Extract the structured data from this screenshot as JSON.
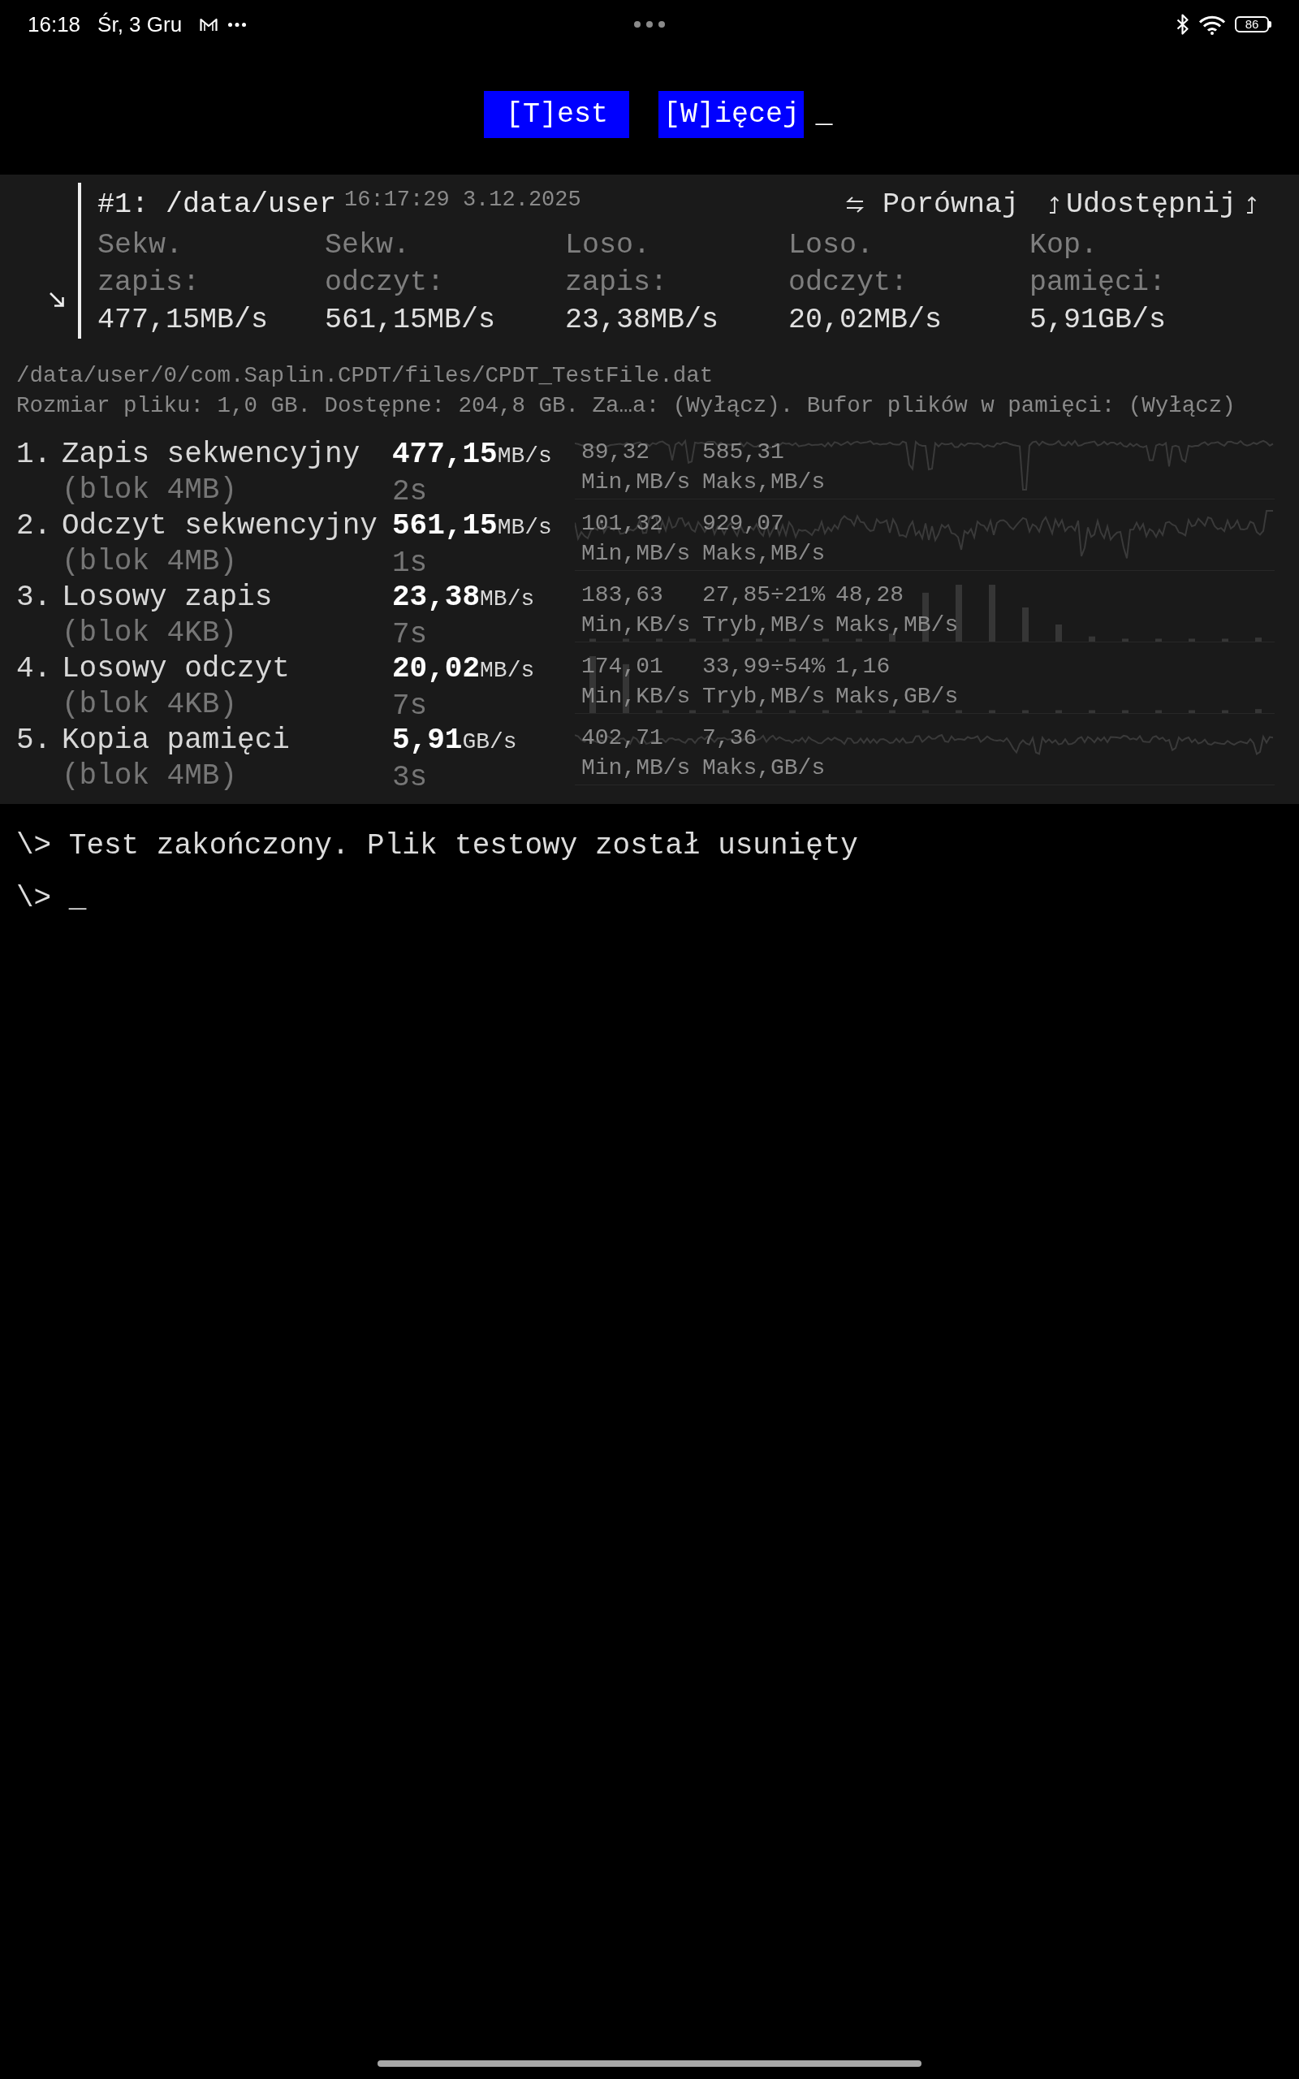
{
  "status_bar": {
    "time": "16:18",
    "date": "Śr, 3 Gru",
    "battery": "86"
  },
  "menu": {
    "buttons": [
      "[T]est",
      "[W]ięcej"
    ],
    "cursor": "_"
  },
  "result": {
    "title": "#1: /data/user",
    "timestamp": "16:17:29 3.12.2025",
    "actions": [
      {
        "kind": "compare",
        "label": "Porównaj"
      },
      {
        "kind": "share",
        "label": "Udostępnij"
      }
    ],
    "summary": [
      {
        "label": "Sekw. zapis:",
        "value": "477,15MB/s"
      },
      {
        "label": "Sekw. odczyt:",
        "value": "561,15MB/s"
      },
      {
        "label": "Loso. zapis:",
        "value": "23,38MB/s"
      },
      {
        "label": "Loso. odczyt:",
        "value": "20,02MB/s"
      },
      {
        "label": "Kop. pamięci:",
        "value": "5,91GB/s"
      }
    ]
  },
  "file": {
    "path": "/data/user/0/com.Saplin.CPDT/files/CPDT_TestFile.dat",
    "info": "Rozmiar pliku: 1,0 GB. Dostępne: 204,8 GB. Za…a: (Wyłącz). Bufor plików w pamięci: (Wyłącz)"
  },
  "tests": [
    {
      "number": "1.",
      "name": "Zapis sekwencyjny",
      "block": "(blok 4MB)",
      "speed": "477,15",
      "unit": "MB/s",
      "time": "2s",
      "kind": "sparkline",
      "stats": [
        {
          "value": "89,32",
          "label": "Min,MB/s"
        },
        {
          "value": "585,31",
          "label": "Maks,MB/s"
        }
      ]
    },
    {
      "number": "2.",
      "name": "Odczyt sekwencyjny",
      "block": "(blok 4MB)",
      "speed": "561,15",
      "unit": "MB/s",
      "time": "1s",
      "kind": "sparkline",
      "stats": [
        {
          "value": "101,32",
          "label": "Min,MB/s"
        },
        {
          "value": "929,07",
          "label": "Maks,MB/s"
        }
      ]
    },
    {
      "number": "3.",
      "name": "Losowy zapis",
      "block": "(blok 4KB)",
      "speed": "23,38",
      "unit": "MB/s",
      "time": "7s",
      "kind": "histogram",
      "stats": [
        {
          "value": "183,63",
          "label": "Min,KB/s"
        },
        {
          "value": "27,85÷21%",
          "label": "Tryb,MB/s"
        },
        {
          "value": "48,28",
          "label": "Maks,MB/s"
        }
      ]
    },
    {
      "number": "4.",
      "name": "Losowy odczyt",
      "block": "(blok 4KB)",
      "speed": "20,02",
      "unit": "MB/s",
      "time": "7s",
      "kind": "histogram",
      "stats": [
        {
          "value": "174,01",
          "label": "Min,KB/s"
        },
        {
          "value": "33,99÷54%",
          "label": "Tryb,MB/s"
        },
        {
          "value": "1,16",
          "label": "Maks,GB/s"
        }
      ]
    },
    {
      "number": "5.",
      "name": "Kopia pamięci",
      "block": "(blok 4MB)",
      "speed": "5,91",
      "unit": "GB/s",
      "time": "3s",
      "kind": "sparkline",
      "stats": [
        {
          "value": "402,71",
          "label": "Min,MB/s"
        },
        {
          "value": "7,36",
          "label": "Maks,GB/s"
        }
      ]
    }
  ],
  "console": {
    "lines": [
      {
        "prompt": "\\>",
        "text": "Test zakończony. Plik testowy został usunięty"
      }
    ],
    "input": {
      "prompt": "\\>",
      "cursor": "_"
    }
  }
}
